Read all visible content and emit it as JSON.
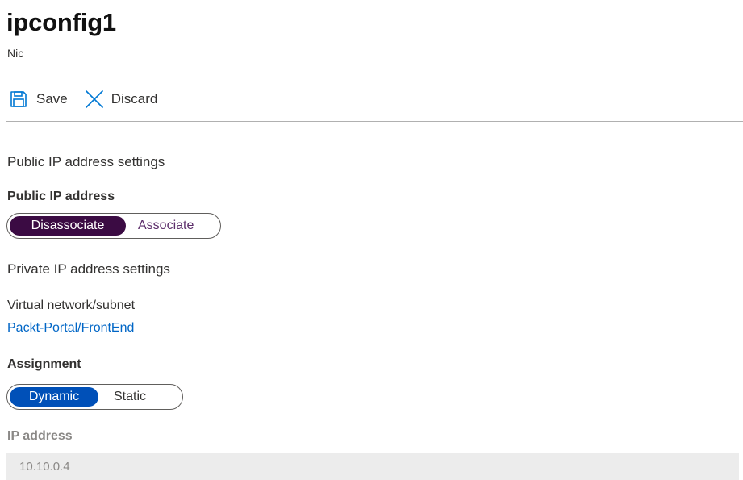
{
  "header": {
    "title": "ipconfig1",
    "subtitle": "Nic"
  },
  "toolbar": {
    "save_label": "Save",
    "save_icon": "save-icon",
    "discard_label": "Discard",
    "discard_icon": "close-icon",
    "icon_color": "#0078d4"
  },
  "public_ip": {
    "section_title": "Public IP address settings",
    "field_label": "Public IP address",
    "options": [
      "Disassociate",
      "Associate"
    ],
    "selected": "Disassociate",
    "accent_color": "#3b0b43"
  },
  "private_ip": {
    "section_title": "Private IP address settings",
    "vnet_label": "Virtual network/subnet",
    "vnet_link": "Packt-Portal/FrontEnd",
    "assignment_label": "Assignment",
    "assignment_options": [
      "Dynamic",
      "Static"
    ],
    "assignment_selected": "Dynamic",
    "accent_color": "#0050b8",
    "ip_label": "IP address",
    "ip_value": "10.10.0.4"
  }
}
